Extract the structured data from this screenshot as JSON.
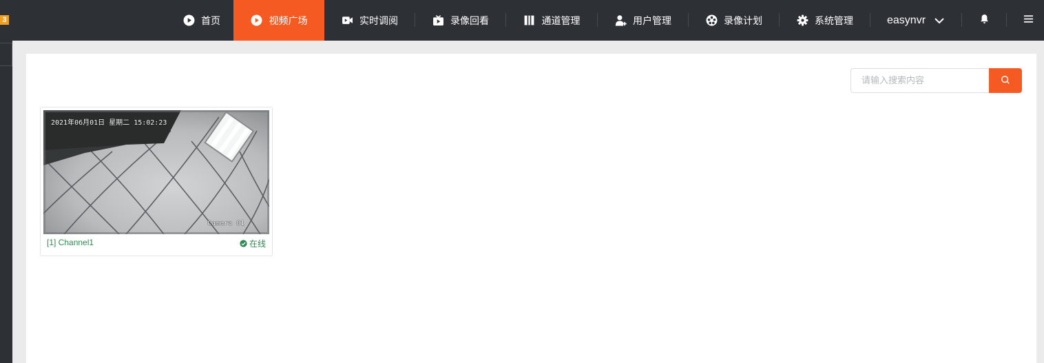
{
  "brand": {
    "badge": "3"
  },
  "nav": [
    {
      "id": "home",
      "label": "首页",
      "icon": "play-circle-icon",
      "active": false
    },
    {
      "id": "video-square",
      "label": "视频广场",
      "icon": "play-circle-icon",
      "active": true
    },
    {
      "id": "live-view",
      "label": "实时调阅",
      "icon": "video-camera-icon",
      "active": false
    },
    {
      "id": "playback",
      "label": "录像回看",
      "icon": "tv-play-icon",
      "active": false
    },
    {
      "id": "channels",
      "label": "通道管理",
      "icon": "columns-icon",
      "active": false
    },
    {
      "id": "users",
      "label": "用户管理",
      "icon": "user-plus-icon",
      "active": false
    },
    {
      "id": "record-plan",
      "label": "录像计划",
      "icon": "film-reel-icon",
      "active": false
    },
    {
      "id": "system",
      "label": "系统管理",
      "icon": "gear-icon",
      "active": false
    }
  ],
  "user": {
    "name": "easynvr"
  },
  "search": {
    "placeholder": "请输入搜索内容"
  },
  "channels": [
    {
      "name": "[1] Channel1",
      "status": "在线",
      "status_color": "#2f8a52",
      "osd_datetime": "2021年06月01日  星期二  15:02:23",
      "osd_camera": "Camera 01"
    }
  ],
  "colors": {
    "accent": "#f55a23",
    "topbar": "#2d3136",
    "online": "#2f8a52"
  }
}
